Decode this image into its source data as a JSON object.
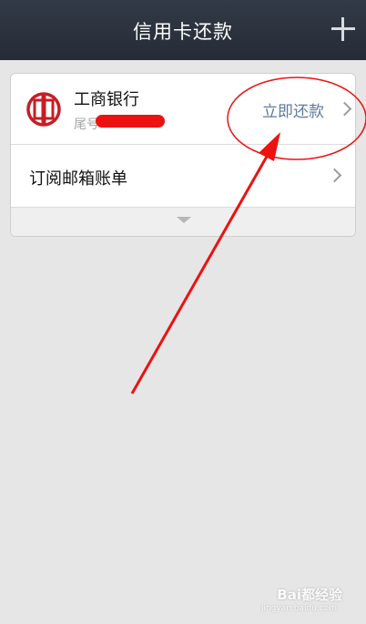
{
  "header": {
    "title": "信用卡还款"
  },
  "bank_card": {
    "bank_name": "工商银行",
    "tail_label": "尾号",
    "repay_label": "立即还款"
  },
  "subscribe": {
    "label": "订阅邮箱账单"
  },
  "watermark": {
    "brand": "Bai都经验",
    "url": "jingyan.baidu.com"
  },
  "colors": {
    "header_bg": "#2b323d",
    "accent_link": "#5d7a9f",
    "annotation": "#ee1111",
    "page_bg": "#e6e6e6",
    "bank_logo": "#c81d25"
  },
  "icons": [
    "plus-icon",
    "icbc-logo-icon",
    "chevron-right-icon",
    "chevron-down-icon"
  ]
}
